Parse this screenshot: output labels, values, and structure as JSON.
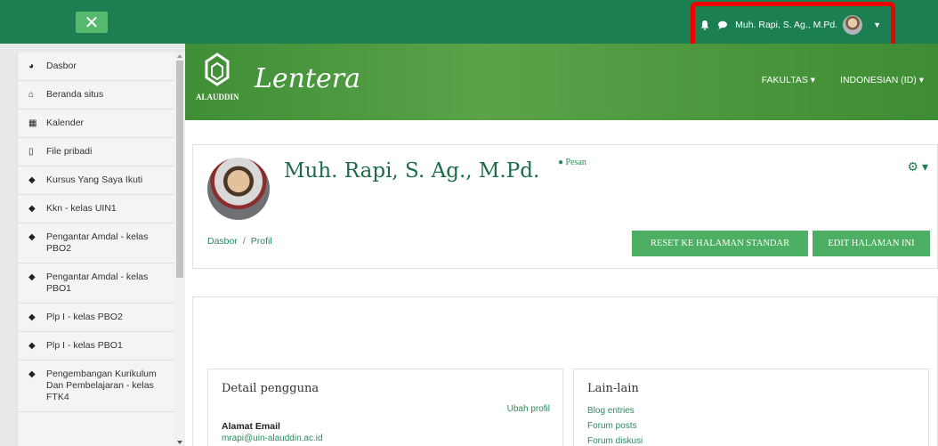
{
  "topbar": {
    "close_glyph": "✕",
    "user_name": "Muh. Rapi, S. Ag., M.Pd.",
    "caret": "▼",
    "icons": [
      "bell-icon",
      "chat-icon"
    ]
  },
  "sidebar": {
    "items": [
      {
        "label": "Dasbor",
        "icon": "dashboard-icon"
      },
      {
        "label": "Beranda situs",
        "icon": "home-icon"
      },
      {
        "label": "Kalender",
        "icon": "calendar-icon"
      },
      {
        "label": "File pribadi",
        "icon": "file-icon"
      },
      {
        "label": "Kursus Yang Saya Ikuti",
        "icon": "graduation-cap-icon"
      },
      {
        "label": "Kkn - kelas UIN1",
        "icon": "graduation-cap-icon"
      },
      {
        "label": "Pengantar Amdal - kelas PBO2",
        "icon": "graduation-cap-icon"
      },
      {
        "label": "Pengantar Amdal - kelas PBO1",
        "icon": "graduation-cap-icon"
      },
      {
        "label": "Plp I - kelas PBO2",
        "icon": "graduation-cap-icon"
      },
      {
        "label": "Plp I - kelas PBO1",
        "icon": "graduation-cap-icon"
      },
      {
        "label": "Pengembangan Kurikulum Dan Pembelajaran - kelas FTK4",
        "icon": "graduation-cap-icon"
      }
    ]
  },
  "banner": {
    "logo_text": "ALAUDDIN",
    "brand": "Lentera",
    "menu": [
      "FAKULTAS ▾",
      "INDONESIAN (ID) ▾"
    ]
  },
  "profile": {
    "name": "Muh. Rapi, S. Ag., M.Pd.",
    "message_link": "Pesan",
    "breadcrumb": [
      "Dasbor",
      "Profil"
    ],
    "breadcrumb_sep": "/",
    "reset_button": "RESET KE HALAMAN STANDAR",
    "edit_button": "EDIT HALAMAN INI"
  },
  "user_details": {
    "title": "Detail pengguna",
    "edit_link": "Ubah profil",
    "email_label": "Alamat Email",
    "email_value": "mrapi@uin-alauddin.ac.id"
  },
  "misc": {
    "title": "Lain-lain",
    "links": [
      "Blog entries",
      "Forum posts",
      "Forum diskusi"
    ]
  },
  "colors": {
    "topbar": "#1c7f52",
    "accent": "#4caf63",
    "link": "#2a8a5e",
    "highlight": "#ee0000"
  }
}
